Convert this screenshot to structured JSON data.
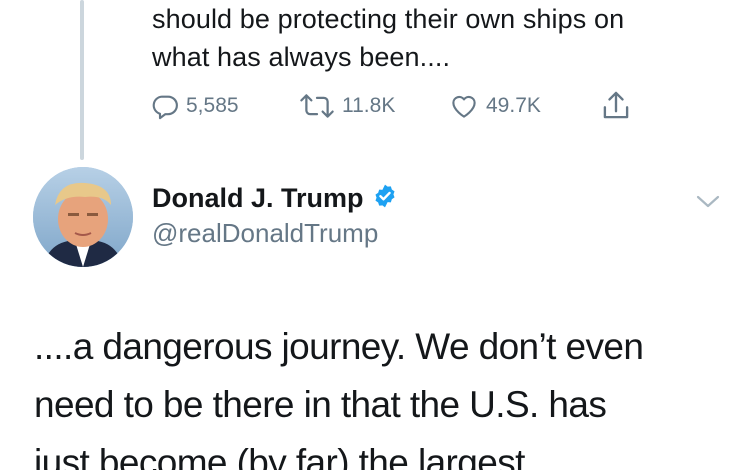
{
  "previous_tweet": {
    "text_lines": [
      "should be protecting their own ships on",
      "what has always been...."
    ],
    "actions": {
      "replies": "5,585",
      "retweets": "11.8K",
      "likes": "49.7K"
    }
  },
  "tweet": {
    "display_name": "Donald J. Trump",
    "handle": "@realDonaldTrump",
    "verified": true,
    "text_lines": [
      "....a dangerous journey. We don’t even",
      "need to be there in that the U.S. has",
      "just become (by far) the largest"
    ]
  },
  "colors": {
    "text": "#14171a",
    "secondary": "#657786",
    "verified_badge": "#1da1f2",
    "thread_line": "#ccd6dd"
  },
  "icons": [
    "reply-icon",
    "retweet-icon",
    "like-icon",
    "share-icon",
    "verified-badge-icon",
    "chevron-down-icon"
  ]
}
